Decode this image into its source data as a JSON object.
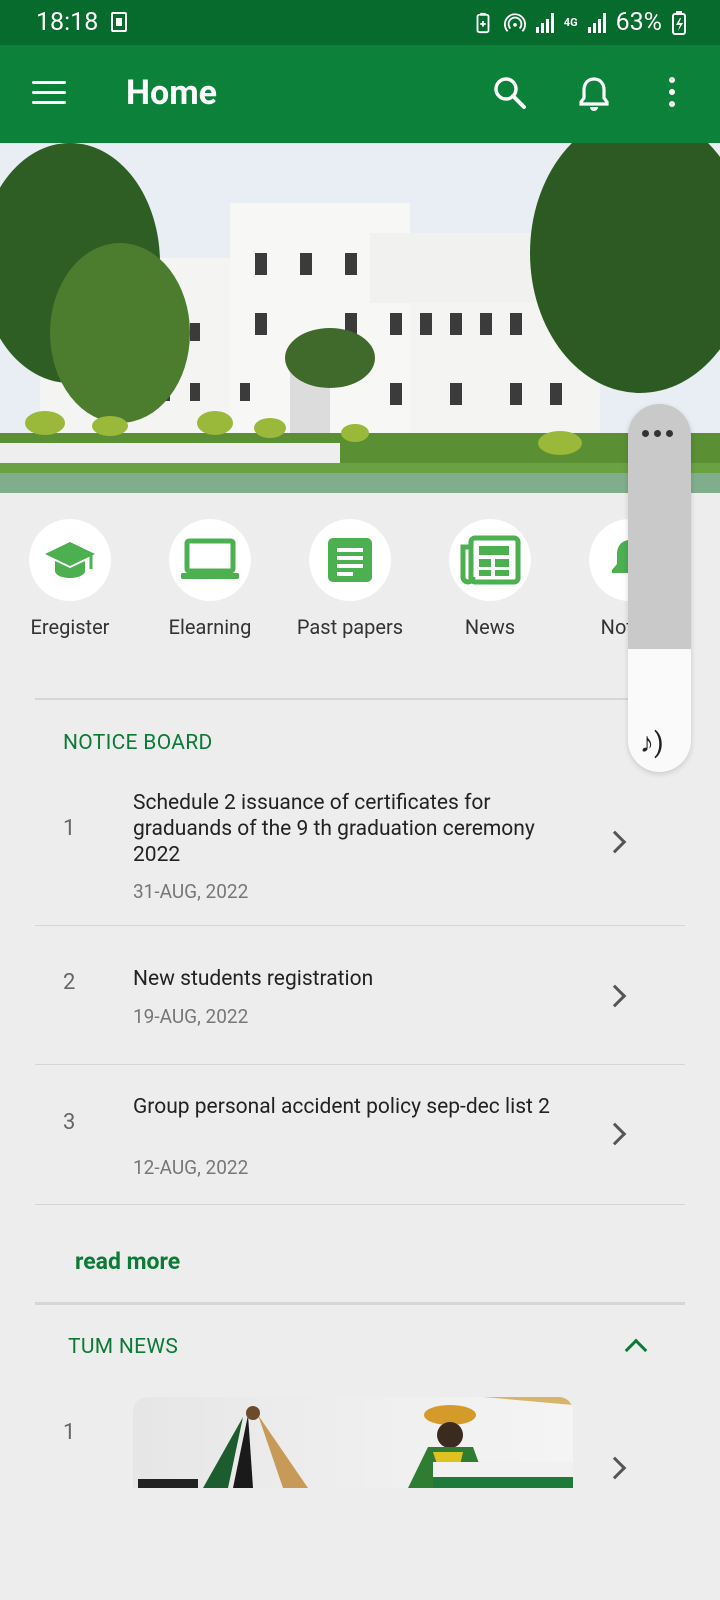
{
  "status_bar": {
    "time": "18:18",
    "network": "4G",
    "battery": "63%"
  },
  "app_bar": {
    "title": "Home"
  },
  "quick_links": [
    {
      "label": "Eregister",
      "icon": "graduation-cap-icon"
    },
    {
      "label": "Elearning",
      "icon": "laptop-icon"
    },
    {
      "label": "Past papers",
      "icon": "document-icon"
    },
    {
      "label": "News",
      "icon": "newspaper-icon"
    },
    {
      "label": "Notific",
      "icon": "bell-icon"
    }
  ],
  "notice_board": {
    "title": "NOTICE BOARD",
    "items": [
      {
        "num": "1",
        "text": "Schedule 2 issuance of certificates for graduands of the 9 th  graduation ceremony 2022",
        "date": "31-AUG, 2022"
      },
      {
        "num": "2",
        "text": "New students registration",
        "date": "19-AUG, 2022"
      },
      {
        "num": "3",
        "text": "Group personal accident policy sep-dec list 2",
        "date": "12-AUG, 2022"
      }
    ],
    "read_more": "read more"
  },
  "news": {
    "title": "TUM NEWS",
    "items": [
      {
        "num": "1"
      }
    ]
  },
  "colors": {
    "status_bar": "#066b2c",
    "app_bar": "#0b8139",
    "accent": "#0b7a36",
    "icon_green": "#4caf50",
    "background": "#ededed"
  }
}
